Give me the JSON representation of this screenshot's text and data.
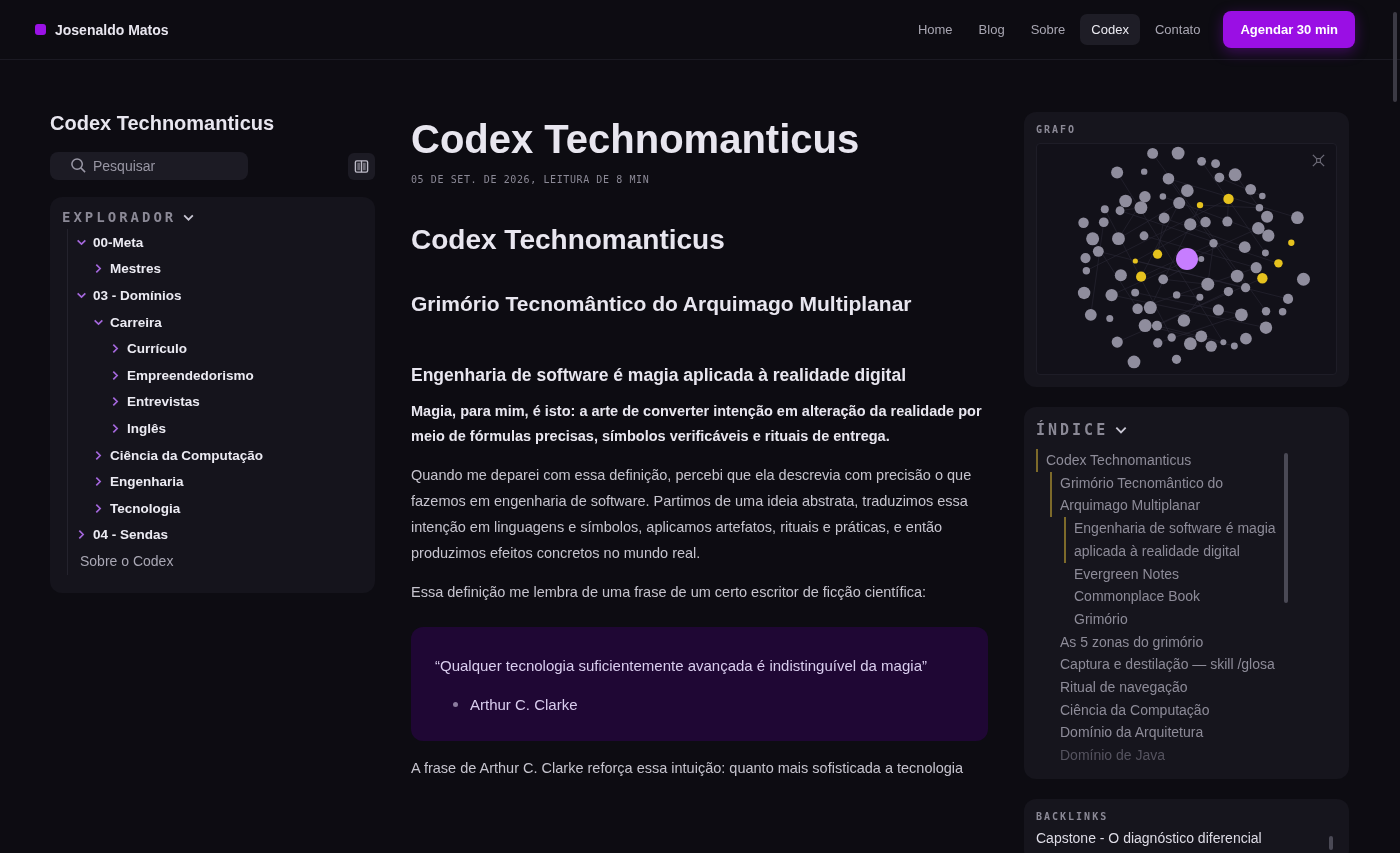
{
  "header": {
    "brand": "Josenaldo Matos",
    "nav": [
      {
        "label": "Home",
        "selected": false
      },
      {
        "label": "Blog",
        "selected": false
      },
      {
        "label": "Sobre",
        "selected": false
      },
      {
        "label": "Codex",
        "selected": true
      },
      {
        "label": "Contato",
        "selected": false
      }
    ],
    "cta": "Agendar 30 min"
  },
  "sidebar": {
    "title": "Codex Technomanticus",
    "search": {
      "placeholder": "Pesquisar"
    },
    "explorer": {
      "label": "EXPLORADOR",
      "expanded": true,
      "items": [
        {
          "kind": "folder",
          "label": "00-Meta",
          "expanded": true,
          "children": [
            {
              "kind": "folder",
              "label": "Mestres",
              "expanded": false
            }
          ]
        },
        {
          "kind": "folder",
          "label": "03 - Domínios",
          "expanded": true,
          "children": [
            {
              "kind": "folder",
              "label": "Carreira",
              "expanded": true,
              "children": [
                {
                  "kind": "folder",
                  "label": "Currículo",
                  "expanded": false
                },
                {
                  "kind": "folder",
                  "label": "Empreendedorismo",
                  "expanded": false
                },
                {
                  "kind": "folder",
                  "label": "Entrevistas",
                  "expanded": false
                },
                {
                  "kind": "folder",
                  "label": "Inglês",
                  "expanded": false
                }
              ]
            },
            {
              "kind": "folder",
              "label": "Ciência da Computação",
              "expanded": false
            },
            {
              "kind": "folder",
              "label": "Engenharia",
              "expanded": false
            },
            {
              "kind": "folder",
              "label": "Tecnologia",
              "expanded": false
            }
          ]
        },
        {
          "kind": "folder",
          "label": "04 - Sendas",
          "expanded": false
        },
        {
          "kind": "note",
          "label": "Sobre o Codex"
        }
      ]
    }
  },
  "article": {
    "title": "Codex Technomanticus",
    "meta": "05 DE SET. DE 2026, LEITURA DE 8 MIN",
    "blocks": [
      {
        "kind": "h1",
        "text": "Codex Technomanticus"
      },
      {
        "kind": "h2",
        "text": "Grimório Tecnomântico do Arquimago Multiplanar"
      },
      {
        "kind": "h3",
        "text": "Engenharia de software é magia aplicada à realidade digital"
      },
      {
        "kind": "strong",
        "text": "Magia, para mim, é isto: a arte de converter intenção em alteração da realidade por meio de fórmulas precisas, símbolos verificáveis e rituais de entrega."
      },
      {
        "kind": "p",
        "text": "Quando me deparei com essa definição, percebi que ela descrevia com precisão o que fazemos em engenharia de software. Partimos de uma ideia abstrata, traduzimos essa intenção em linguagens e símbolos, aplicamos artefatos, rituais e práticas, e então produzimos efeitos concretos no mundo real."
      },
      {
        "kind": "p",
        "text": "Essa definição me lembra de uma frase de um certo escritor de ficção científica:"
      },
      {
        "kind": "quote",
        "text": "“Qualquer tecnologia suficientemente avançada é indistinguível da magia”",
        "author": "Arthur C. Clarke"
      },
      {
        "kind": "p",
        "text": "A frase de Arthur C. Clarke reforça essa intuição: quanto mais sofisticada a tecnologia"
      }
    ]
  },
  "graph": {
    "label": "GRAFO"
  },
  "toc": {
    "label": "ÍNDICE",
    "expanded": true,
    "items": [
      {
        "text": "Codex Technomanticus",
        "active": true,
        "children": [
          {
            "text": "Grimório Tecnomântico do Arquimago Multiplanar",
            "active": true,
            "children": [
              {
                "text": "Engenharia de software é magia aplicada à realidade digital",
                "active": true
              },
              {
                "text": "Evergreen Notes",
                "active": false
              },
              {
                "text": "Commonplace Book",
                "active": false
              },
              {
                "text": "Grimório",
                "active": false
              }
            ]
          },
          {
            "text": "As 5 zonas do grimório",
            "active": false
          },
          {
            "text": "Captura e destilação — skill /glosa",
            "active": false
          },
          {
            "text": "Ritual de navegação",
            "active": false
          },
          {
            "text": "Ciência da Computação",
            "active": false
          },
          {
            "text": "Domínio da Arquitetura",
            "active": false
          },
          {
            "text": "Domínio de Java",
            "active": false
          }
        ]
      }
    ]
  },
  "backlinks": {
    "label": "BACKLINKS",
    "items": [
      "Capstone - O diagnóstico diferencial"
    ]
  }
}
